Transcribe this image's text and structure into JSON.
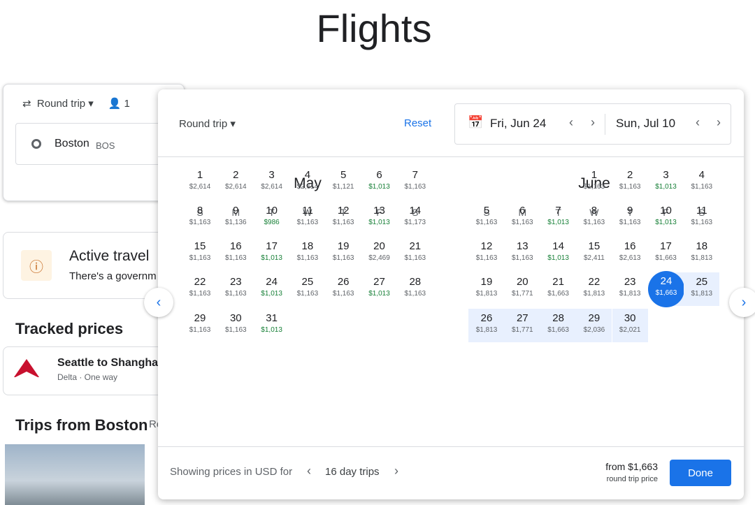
{
  "page_title": "Flights",
  "background": {
    "trip_type": "Round trip",
    "passengers": "1",
    "origin": "Boston",
    "origin_code": "BOS",
    "alert_title": "Active travel",
    "alert_text": "There's a governm",
    "tracked_title": "Tracked prices",
    "tracked_route": "Seattle to Shangha",
    "tracked_meta": "Delta · One way",
    "trips_title": "Trips from Boston",
    "trips_link": "Re"
  },
  "modal": {
    "trip_type": "Round trip",
    "reset": "Reset",
    "depart": "Fri, Jun 24",
    "return": "Sun, Jul 10",
    "weekdays": [
      "S",
      "M",
      "T",
      "W",
      "T",
      "F",
      "S"
    ],
    "months": [
      {
        "name": "May",
        "days": [
          {
            "d": 1,
            "p": "$2,614"
          },
          {
            "d": 2,
            "p": "$2,614"
          },
          {
            "d": 3,
            "p": "$2,614"
          },
          {
            "d": 4,
            "p": "$2,614"
          },
          {
            "d": 5,
            "p": "$1,121"
          },
          {
            "d": 6,
            "p": "$1,013",
            "low": true
          },
          {
            "d": 7,
            "p": "$1,163"
          },
          {
            "d": 8,
            "p": "$1,163"
          },
          {
            "d": 9,
            "p": "$1,136"
          },
          {
            "d": 10,
            "p": "$986",
            "low": true
          },
          {
            "d": 11,
            "p": "$1,163"
          },
          {
            "d": 12,
            "p": "$1,163"
          },
          {
            "d": 13,
            "p": "$1,013",
            "low": true
          },
          {
            "d": 14,
            "p": "$1,173"
          },
          {
            "d": 15,
            "p": "$1,163"
          },
          {
            "d": 16,
            "p": "$1,163"
          },
          {
            "d": 17,
            "p": "$1,013",
            "low": true
          },
          {
            "d": 18,
            "p": "$1,163"
          },
          {
            "d": 19,
            "p": "$1,163"
          },
          {
            "d": 20,
            "p": "$2,469"
          },
          {
            "d": 21,
            "p": "$1,163"
          },
          {
            "d": 22,
            "p": "$1,163"
          },
          {
            "d": 23,
            "p": "$1,163"
          },
          {
            "d": 24,
            "p": "$1,013",
            "low": true
          },
          {
            "d": 25,
            "p": "$1,163"
          },
          {
            "d": 26,
            "p": "$1,163"
          },
          {
            "d": 27,
            "p": "$1,013",
            "low": true
          },
          {
            "d": 28,
            "p": "$1,163"
          },
          {
            "d": 29,
            "p": "$1,163"
          },
          {
            "d": 30,
            "p": "$1,163"
          },
          {
            "d": 31,
            "p": "$1,013",
            "low": true
          }
        ]
      },
      {
        "name": "June",
        "days": [
          {
            "d": 1,
            "p": "$1,163"
          },
          {
            "d": 2,
            "p": "$1,163"
          },
          {
            "d": 3,
            "p": "$1,013",
            "low": true
          },
          {
            "d": 4,
            "p": "$1,163"
          },
          {
            "d": 5,
            "p": "$1,163"
          },
          {
            "d": 6,
            "p": "$1,163"
          },
          {
            "d": 7,
            "p": "$1,013",
            "low": true
          },
          {
            "d": 8,
            "p": "$1,163"
          },
          {
            "d": 9,
            "p": "$1,163"
          },
          {
            "d": 10,
            "p": "$1,013",
            "low": true
          },
          {
            "d": 11,
            "p": "$1,163"
          },
          {
            "d": 12,
            "p": "$1,163"
          },
          {
            "d": 13,
            "p": "$1,163"
          },
          {
            "d": 14,
            "p": "$1,013",
            "low": true
          },
          {
            "d": 15,
            "p": "$2,411"
          },
          {
            "d": 16,
            "p": "$2,613"
          },
          {
            "d": 17,
            "p": "$1,663"
          },
          {
            "d": 18,
            "p": "$1,813"
          },
          {
            "d": 19,
            "p": "$1,813"
          },
          {
            "d": 20,
            "p": "$1,771"
          },
          {
            "d": 21,
            "p": "$1,663"
          },
          {
            "d": 22,
            "p": "$1,813"
          },
          {
            "d": 23,
            "p": "$1,813"
          },
          {
            "d": 24,
            "p": "$1,663",
            "selected": true
          },
          {
            "d": 25,
            "p": "$1,813",
            "range": true
          },
          {
            "d": 26,
            "p": "$1,813",
            "range": true
          },
          {
            "d": 27,
            "p": "$1,771",
            "range": true
          },
          {
            "d": 28,
            "p": "$1,663",
            "range": true
          },
          {
            "d": 29,
            "p": "$2,036",
            "range": true
          },
          {
            "d": 30,
            "p": "$2,021",
            "range": true
          }
        ]
      }
    ],
    "footer_prefix": "Showing prices in USD for",
    "trip_length": "16 day trips",
    "price": "from $1,663",
    "price_note": "round trip price",
    "done": "Done"
  },
  "colors": {
    "accent": "#1a73e8",
    "low_price": "#188038",
    "range": "#e8f0fe"
  }
}
